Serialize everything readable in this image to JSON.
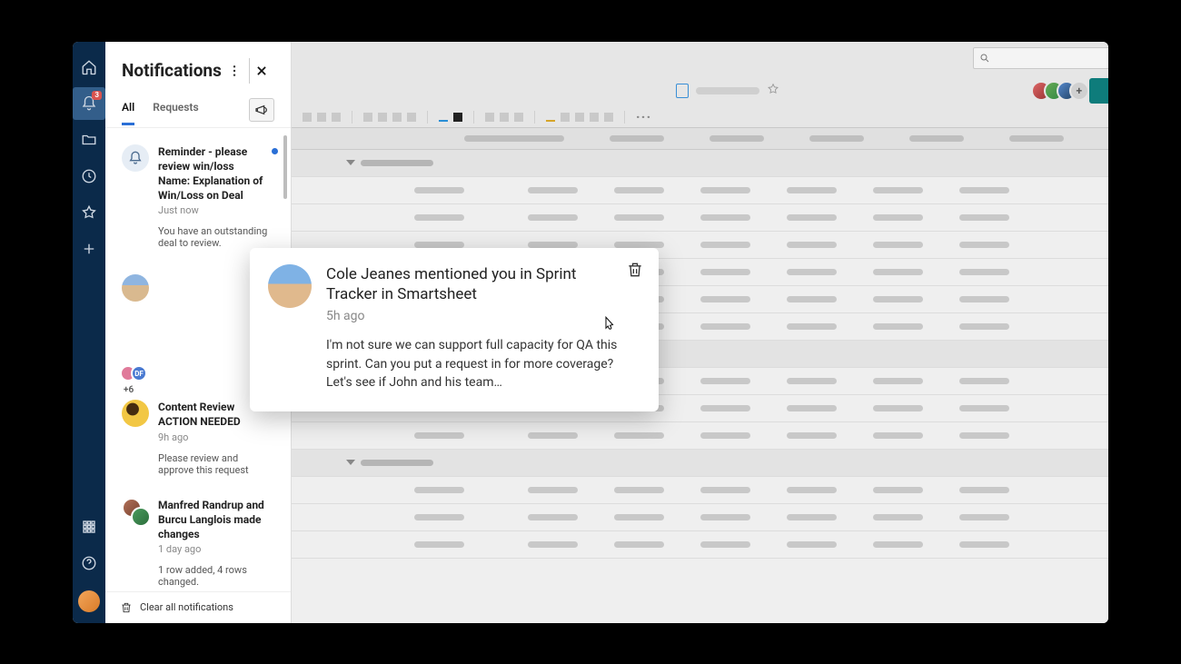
{
  "rail": {
    "notification_badge": "3"
  },
  "notifications": {
    "title": "Notifications",
    "tabs": {
      "all": "All",
      "requests": "Requests"
    },
    "items": [
      {
        "line1": "Reminder - please review win/loss",
        "line2": "Name: Explanation of Win/Loss on Deal",
        "time": "Just now",
        "desc": "You have an outstanding deal to review."
      },
      {
        "line1": "Cole Jeanes mentioned you in Sprint Tracker in Smartsheet",
        "time": "5h ago",
        "plus": "+6",
        "df": "DF"
      },
      {
        "line1": "Content Review",
        "line2": "ACTION NEEDED",
        "time": "9h ago",
        "desc": "Please review and approve this request"
      },
      {
        "line1": "Manfred Randrup and Burcu Langlois made changes",
        "time": "1 day ago",
        "desc": "1 row added, 4 rows changed."
      }
    ],
    "clear_all": "Clear all notifications"
  },
  "popup": {
    "title": "Cole Jeanes mentioned you in Sprint Tracker in Smartsheet",
    "time": "5h ago",
    "message": "I'm not sure we can support full capacity for QA this sprint. Can you put a request in for more coverage? Let's see if John and his team…"
  },
  "share": {
    "more": "+"
  }
}
